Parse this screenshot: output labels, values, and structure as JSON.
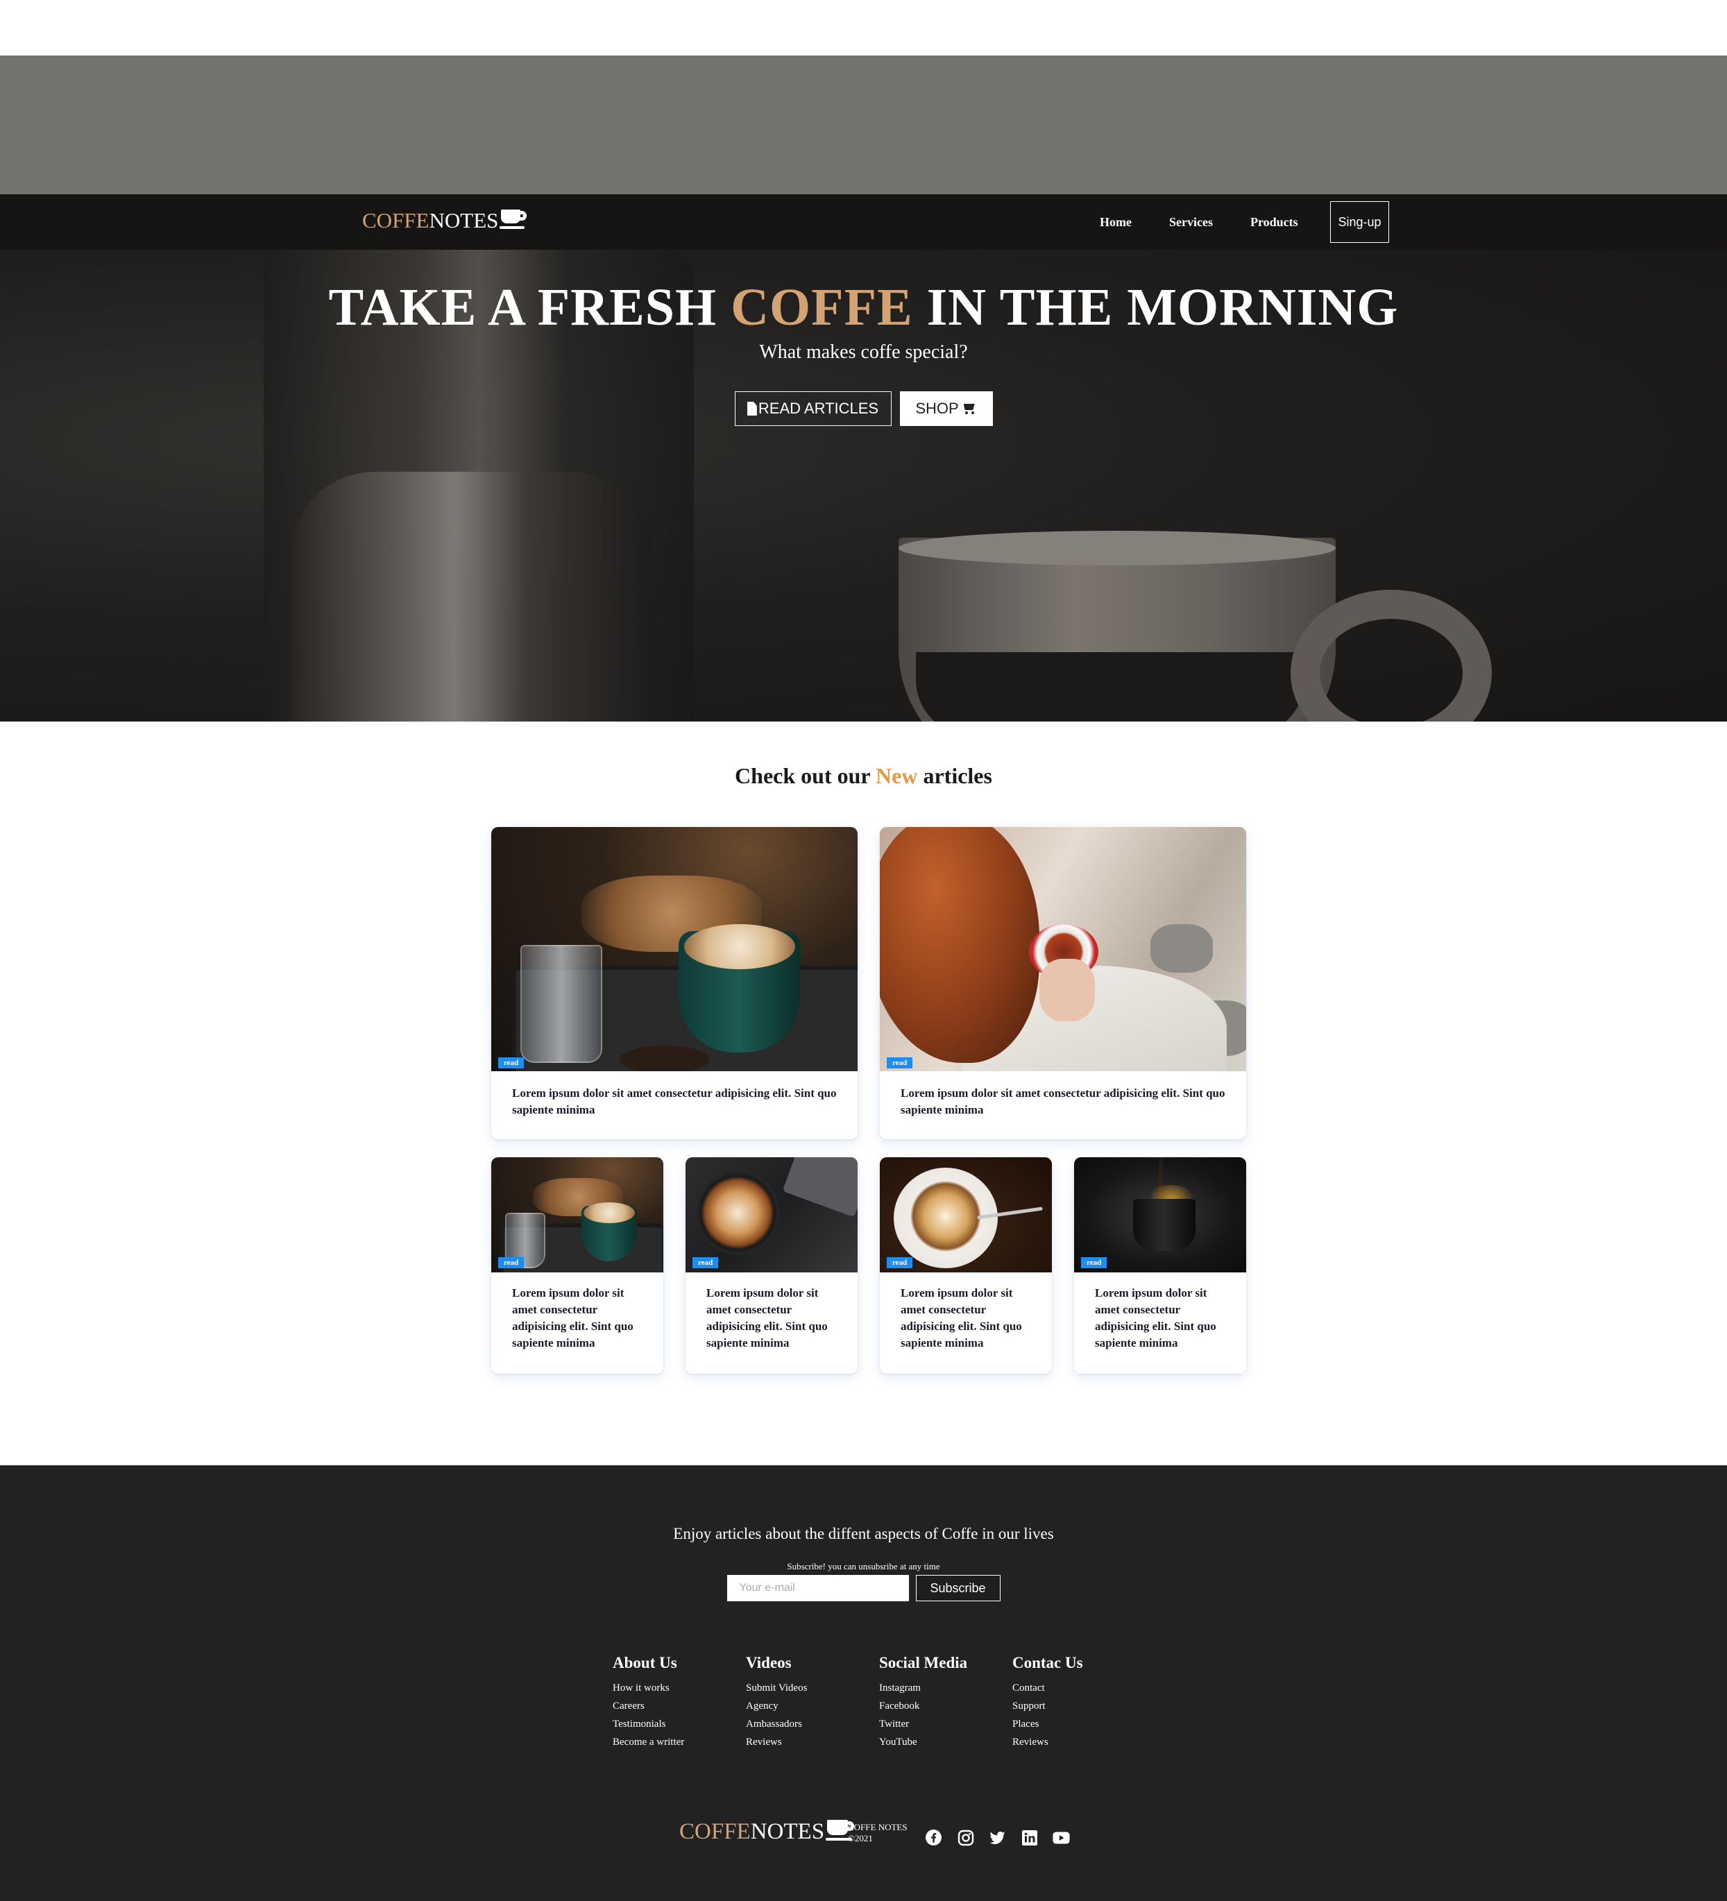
{
  "nav": {
    "brand_a": "COFFE",
    "brand_b": "NOTES",
    "links": [
      "Home",
      "Services",
      "Products"
    ],
    "signup_label": "Sing-up"
  },
  "hero": {
    "title_pre": "TAKE A FRESH ",
    "title_accent": "COFFE",
    "title_post": " IN THE MORNING",
    "subtitle": "What makes coffe special?",
    "read_btn": "READ ARTICLES",
    "shop_btn": "SHOP"
  },
  "articles": {
    "title_pre": "Check out our ",
    "title_accent": "New",
    "title_post": " articles",
    "cards": [
      {
        "tag": "read",
        "text": "Lorem ipsum dolor sit amet consectetur adipisicing elit. Sint quo sapiente minima"
      },
      {
        "tag": "read",
        "text": "Lorem ipsum dolor sit amet consectetur adipisicing elit. Sint quo sapiente minima"
      },
      {
        "tag": "read",
        "text": "Lorem ipsum dolor sit amet consectetur adipisicing elit. Sint quo sapiente minima"
      },
      {
        "tag": "read",
        "text": "Lorem ipsum dolor sit amet consectetur adipisicing elit. Sint quo sapiente minima"
      },
      {
        "tag": "read",
        "text": "Lorem ipsum dolor sit amet consectetur adipisicing elit. Sint quo sapiente minima"
      },
      {
        "tag": "read",
        "text": "Lorem ipsum dolor sit amet consectetur adipisicing elit. Sint quo sapiente minima"
      }
    ]
  },
  "footer": {
    "tagline": "Enjoy articles about the diffent aspects of Coffe in our lives",
    "note": "Subscribe! you can unsubsribe at any time",
    "email_placeholder": "Your e-mail",
    "subscribe_label": "Subscribe",
    "columns": [
      {
        "title": "About Us",
        "links": [
          "How it works",
          "Careers",
          "Testimonials",
          "Become a writter"
        ]
      },
      {
        "title": "Videos",
        "links": [
          "Submit Videos",
          "Agency",
          "Ambassadors",
          "Reviews"
        ]
      },
      {
        "title": "Social Media",
        "links": [
          "Instagram",
          "Facebook",
          "Twitter",
          "YouTube"
        ]
      },
      {
        "title": "Contac Us",
        "links": [
          "Contact",
          "Support",
          "Places",
          "Reviews"
        ]
      }
    ],
    "brand_a": "COFFE",
    "brand_b": "NOTES",
    "copy_line1": "COFFE NOTES",
    "copy_line2": "©2021",
    "socials": [
      "facebook-icon",
      "instagram-icon",
      "twitter-icon",
      "linkedin-icon",
      "youtube-icon"
    ]
  },
  "colors": {
    "accent": "#d4a373",
    "new_accent": "#e09b4b",
    "tag_blue": "#1d8ef0",
    "nav_bg": "#161514",
    "footer_bg": "#222222"
  }
}
